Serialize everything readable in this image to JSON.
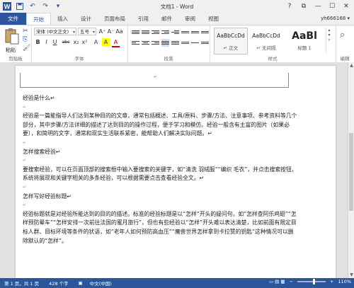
{
  "window": {
    "title": "文档1 - Word"
  },
  "qat": {
    "save_icon": "save-icon",
    "undo_icon": "undo-icon",
    "redo_icon": "redo-icon",
    "customize_icon": "customize-icon"
  },
  "win_buttons": {
    "help": "?",
    "restore": "⧉",
    "minimize": "—",
    "maximize": "☐",
    "close": "✕"
  },
  "tabs": [
    "文件",
    "开始",
    "插入",
    "设计",
    "页面布局",
    "引用",
    "邮件",
    "审阅",
    "视图"
  ],
  "user": {
    "name": "yh666168 ▾"
  },
  "ribbon": {
    "clipboard": {
      "paste": "粘贴",
      "label": "剪贴板"
    },
    "font": {
      "font_name": "宋体 (中文正文)",
      "font_size": "五号",
      "label": "字体",
      "buttons": [
        "B",
        "I",
        "U",
        "abc",
        "x₂",
        "x²",
        "A",
        "A"
      ],
      "top_buttons": [
        "A⁺",
        "A⁻",
        "Aa",
        "A",
        "wén",
        "A"
      ]
    },
    "paragraph": {
      "label": "段落"
    },
    "styles": {
      "label": "样式",
      "items": [
        {
          "sample": "AaBbCcDd",
          "name": "↵ 正文"
        },
        {
          "sample": "AaBbCcDd",
          "name": "↵ 无间隔"
        },
        {
          "sample": "AaBl",
          "name": "标题 1"
        }
      ]
    },
    "editing": {
      "label": "编辑"
    }
  },
  "document": {
    "lines": [
      {
        "type": "heading",
        "text": "经验是什么↵"
      },
      {
        "type": "blank",
        "text": "↵"
      },
      {
        "type": "para",
        "text": "经验是一篇能指导人们达到某种目的的文章，通常包括概述、工具/原料、步骤/方法、注意事项、参考资料等几个部分，其中步骤/方法详细的描述了达到目的的操作过程，便于学习和模仿。经验一般含有主富的图片（如果必要），和简明的文字，通常和现实生活联系紧密，能帮助人们解决实际问题。↵"
      },
      {
        "type": "blank",
        "text": "↵"
      },
      {
        "type": "heading",
        "text": " 怎样搜索经验↵"
      },
      {
        "type": "blank",
        "text": "↵"
      },
      {
        "type": "para",
        "text": "要搜索经验，可以在页面顶部的搜索框中输入要搜索的关键字，如“清洗 羽绒服”“编织 毛衣”，并点击搜索按钮，系统将展现和关键字相关的多条经验，可以根据需要点击查看经验全文。↵"
      },
      {
        "type": "blank",
        "text": "↵"
      },
      {
        "type": "heading",
        "text": " 怎样写好经验标题↵"
      },
      {
        "type": "blank",
        "text": "↵"
      },
      {
        "type": "para",
        "text": "经验标题就是对经验所能达到的目的的描述。标准的经验标题是以“怎样”开头的疑问句，如“怎样查阿乐鸡翅”“怎样预防晕车”“怎样安排一次前往法国的蜜月旅行”，但也有些经验以“怎样”开头难以表达清楚，比如前面有限定目标人群、目标环境等条件的状语，如“老年人如何预防高血压”“魔兽世界怎样拿到卡拉赞的钥匙”这种情况可以删除默认的“怎样”。"
      }
    ]
  },
  "statusbar": {
    "page": "第 1 页，共 1 页",
    "words": "428 个字",
    "lang": "中文(中国)",
    "zoom": "110%",
    "zoom_minus": "−",
    "zoom_plus": "+",
    "view_icons": "▭ ▤ ▦"
  }
}
